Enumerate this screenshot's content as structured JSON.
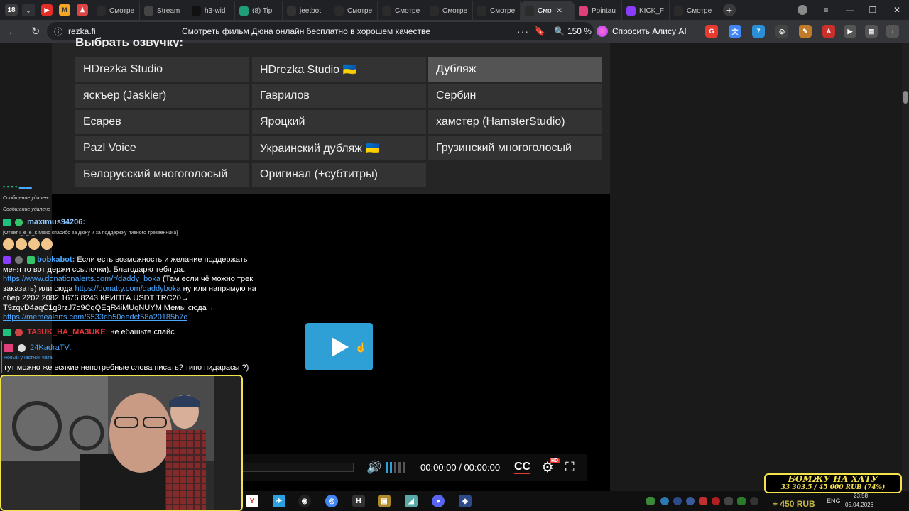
{
  "browser": {
    "tab_count": "18",
    "tabs": [
      {
        "label": "Смотре",
        "icon_color": "#2b2b2b"
      },
      {
        "label": "Stream",
        "icon_color": "#444444"
      },
      {
        "label": "h3-wid",
        "icon_color": "#111111"
      },
      {
        "label": "(8) Tip",
        "icon_color": "#1f9e7a"
      },
      {
        "label": "jeetbot",
        "icon_color": "#333333"
      },
      {
        "label": "Смотре",
        "icon_color": "#2b2b2b"
      },
      {
        "label": "Смотре",
        "icon_color": "#2b2b2b"
      },
      {
        "label": "Смотре",
        "icon_color": "#2b2b2b"
      },
      {
        "label": "Смотре",
        "icon_color": "#2b2b2b"
      },
      {
        "label": "Смо",
        "icon_color": "#2b2b2b",
        "active": true
      },
      {
        "label": "Pointau",
        "icon_color": "#e0407a"
      },
      {
        "label": "KICK_F",
        "icon_color": "#8a3cff"
      },
      {
        "label": "Смотре",
        "icon_color": "#2b2b2b"
      }
    ],
    "url": "rezka.fi",
    "page_title": "Смотреть фильм Дюна онлайн бесплатно в хорошем качестве",
    "zoom": "150 %",
    "alice_label": "Спросить Алису AI"
  },
  "voiceover": {
    "heading": "Выбрать озвучку:",
    "options": [
      {
        "label": "HDrezka Studio"
      },
      {
        "label": "HDrezka Studio 🇺🇦"
      },
      {
        "label": "Дубляж",
        "active": true
      },
      {
        "label": "яскъер (Jaskier)"
      },
      {
        "label": "Гаврилов"
      },
      {
        "label": "Сербин"
      },
      {
        "label": "Есарев"
      },
      {
        "label": "Яроцкий"
      },
      {
        "label": "хамстер (HamsterStudio)"
      },
      {
        "label": "Pazl Voice"
      },
      {
        "label": "Украинский дубляж 🇺🇦"
      },
      {
        "label": "Грузинский многоголосый"
      },
      {
        "label": "Белорусский многоголосый"
      },
      {
        "label": "Оригинал (+субтитры)"
      }
    ]
  },
  "player": {
    "time": "00:00:00 / 00:00:00",
    "cc_label": "CC",
    "hd_label": "HD",
    "volume_level": 0.4
  },
  "chat": {
    "deleted_1": "Сообщение удалено",
    "deleted_2": "Сообщение удалено",
    "msg1_user": "maximus94206:",
    "msg1_reply": "[Ответ I_e_e_I: Макс спасибо за дюну и за поддержку пивного трезвенника]",
    "msg2_user": "bobkabot:",
    "msg2_text_a": "Если есть возможность и желание поддержать меня то вот держи ссылочки). Благодарю тебя да.",
    "msg2_link1": "https://www.donationalerts.com/r/daddy_boka",
    "msg2_text_b": "(Там если чё можно трек заказать) или сюда",
    "msg2_link2": "https://donatty.com/daddyboka",
    "msg2_text_c": "ну или напрямую на сбер 2202 2082 1676 8243 КРИПТА USDT TRC20→ T9zqvD4aqC1g8rzJ7o9CqQEqR4iMUqNUYM Мемы сюда→",
    "msg2_link3": "https://memealerts.com/6533eb50eedcf58a20185b7c",
    "msg3_user": "TA3UK_HA_MA3UKE:",
    "msg3_text": "не ебашьте спайс",
    "msg4_user": "24KadraTV:",
    "msg4_sub": "Новый участник чата",
    "msg4_text": "тут можно же всякие непотребные слова писать? типо пидарасы ?)"
  },
  "donation": {
    "title": "БОМЖУ НА ХАТУ",
    "progress": "33 303.5 / 45 000 RUB (74%)",
    "overlay": "+ 450 RUB"
  },
  "tray": {
    "lang": "ENG",
    "time": "23:58",
    "date": "05.04.2026"
  }
}
